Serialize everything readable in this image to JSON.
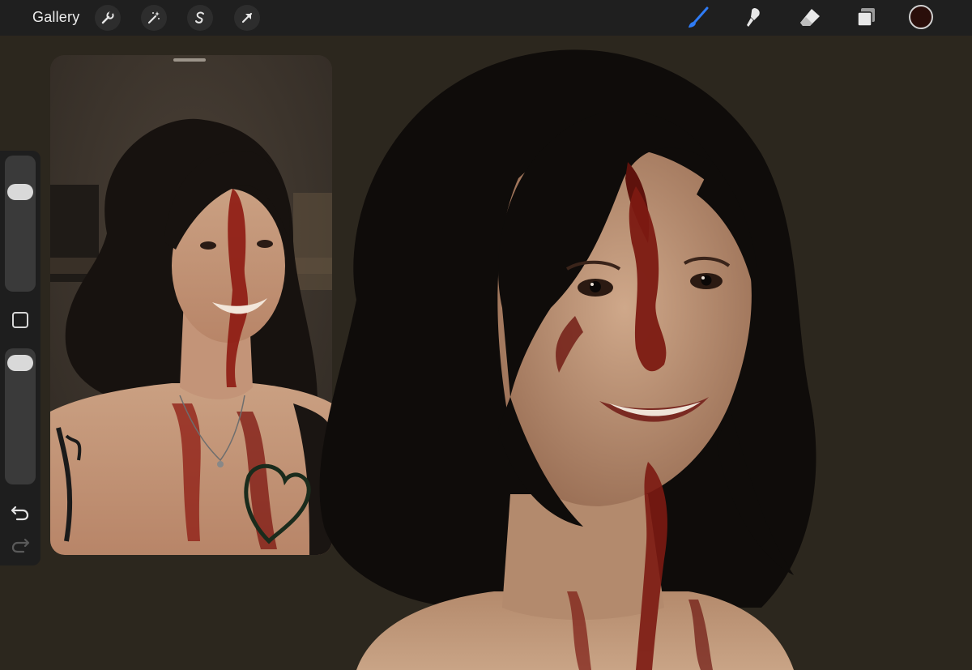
{
  "toolbar": {
    "gallery_label": "Gallery",
    "left_tools": [
      "wrench-icon",
      "magic-wand-icon",
      "selection-icon",
      "transform-arrow-icon"
    ],
    "right_tools": [
      "brush-icon",
      "smudge-icon",
      "eraser-icon",
      "layers-icon"
    ],
    "active_tool": "brush",
    "active_color": "#2a0e0a",
    "accent_color": "#2f7cf6"
  },
  "sidebar": {
    "brush_size_level": 0.78,
    "opacity_level": 0.97,
    "icons": [
      "modify-square-icon",
      "undo-icon",
      "redo-icon"
    ]
  },
  "reference": {
    "icons": [
      "drag-handle"
    ]
  },
  "colors": {
    "canvas_background": "#2c271e",
    "toolbar_background": "#1f1f1f"
  }
}
